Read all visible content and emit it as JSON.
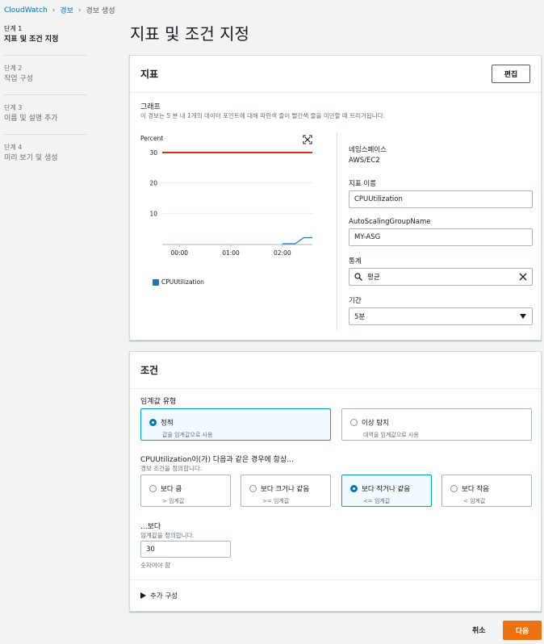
{
  "breadcrumb": {
    "items": [
      "CloudWatch",
      "경보",
      "경보 생성"
    ]
  },
  "steps": [
    {
      "num": "단계 1",
      "title": "지표 및 조건 지정"
    },
    {
      "num": "단계 2",
      "title": "작업 구성"
    },
    {
      "num": "단계 3",
      "title": "이름 및 설명 추가"
    },
    {
      "num": "단계 4",
      "title": "미리 보기 및 생성"
    }
  ],
  "page_title": "지표 및 조건 지정",
  "metric_panel": {
    "title": "지표",
    "edit_label": "편집",
    "graph_label": "그래프",
    "graph_desc": "이 경보는 5 분 내 1개의 데이터 포인트에 대해 파란색 줄이 빨간색 줄을 미만할 때 트리거됩니다.",
    "namespace_label": "네임스페이스",
    "namespace_value": "AWS/EC2",
    "metric_name_label": "지표 이름",
    "metric_name_value": "CPUUtilization",
    "asg_label": "AutoScalingGroupName",
    "asg_value": "MY-ASG",
    "stat_label": "통계",
    "stat_value": "평균",
    "period_label": "기간",
    "period_value": "5분"
  },
  "chart_data": {
    "type": "line",
    "ylabel": "Percent",
    "ylim": [
      0,
      30
    ],
    "yticks": [
      "30",
      "20",
      "10"
    ],
    "xticks": [
      "00:00",
      "01:00",
      "02:00"
    ],
    "series": [
      {
        "name": "CPUUtilization",
        "color": "#1f78b4",
        "x": [
          "00:00",
          "01:00",
          "02:00",
          "02:15",
          "02:25",
          "02:35"
        ],
        "values": [
          0,
          0,
          0,
          0,
          2,
          2
        ]
      }
    ],
    "threshold": {
      "value": 30,
      "color": "#d13212"
    },
    "legend": [
      "CPUUtilization"
    ]
  },
  "condition_panel": {
    "title": "조건",
    "threshold_type_label": "임계값 유형",
    "threshold_types": [
      {
        "label": "정적",
        "desc": "값을 임계값으로 사용",
        "selected": true
      },
      {
        "label": "이상 탐지",
        "desc": "대역을 임계값으로 사용",
        "selected": false
      }
    ],
    "whenever_label": "CPUUtilization이(가) 다음과 같은 경우에 항상...",
    "whenever_desc": "경보 조건을 정의합니다.",
    "conditions": [
      {
        "label": "보다 큼",
        "desc": "> 임계값",
        "selected": false
      },
      {
        "label": "보다 크거나 같음",
        "desc": ">= 임계값",
        "selected": false
      },
      {
        "label": "보다 작거나 같음",
        "desc": "<= 임계값",
        "selected": true
      },
      {
        "label": "보다 작음",
        "desc": "< 임계값",
        "selected": false
      }
    ],
    "than_label": "...보다",
    "than_desc": "임계값을 정의합니다.",
    "than_value": "30",
    "than_hint": "숫자여야 함",
    "additional_label": "추가 구성"
  },
  "footer": {
    "cancel": "취소",
    "next": "다음"
  }
}
